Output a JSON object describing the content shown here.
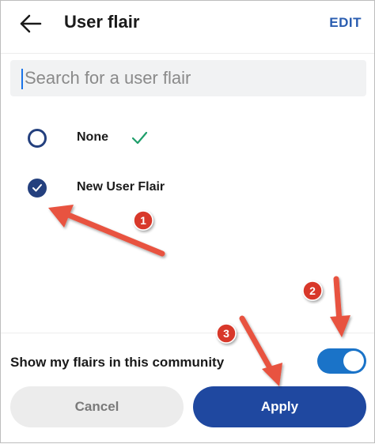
{
  "header": {
    "title": "User flair",
    "edit_label": "EDIT"
  },
  "search": {
    "placeholder": "Search for a user flair"
  },
  "options": [
    {
      "label": "None",
      "selected": false,
      "shows_checkmark": true
    },
    {
      "label": "New User Flair",
      "selected": true,
      "shows_checkmark": false
    }
  ],
  "toggle": {
    "label": "Show my flairs in this community",
    "on": true
  },
  "buttons": {
    "cancel": "Cancel",
    "apply": "Apply"
  },
  "annotations": {
    "badge_1": "1",
    "badge_2": "2",
    "badge_3": "3"
  },
  "colors": {
    "accent": "#1f48a0",
    "toggle": "#1a73c8",
    "annotation": "#e8533f",
    "check": "#1e9e6a"
  }
}
